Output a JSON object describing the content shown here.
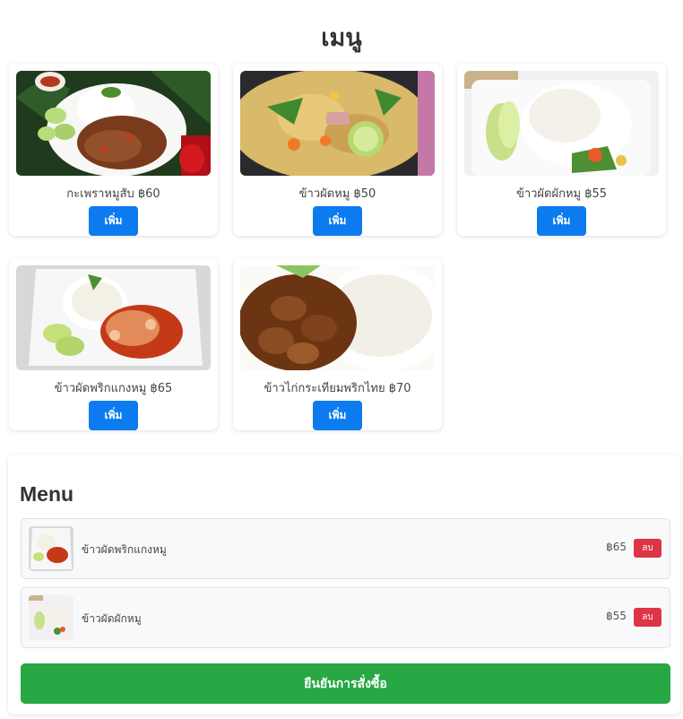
{
  "page": {
    "title": "เมนู"
  },
  "menu": {
    "items": [
      {
        "name": "กะเพราหมูสับ",
        "price": "฿60",
        "label": "กะเพราหมูสับ ฿60",
        "add_label": "เพิ่ม"
      },
      {
        "name": "ข้าวผัดหมู",
        "price": "฿50",
        "label": "ข้าวผัดหมู ฿50",
        "add_label": "เพิ่ม"
      },
      {
        "name": "ข้าวผัดผักหมู",
        "price": "฿55",
        "label": "ข้าวผัดผักหมู ฿55",
        "add_label": "เพิ่ม"
      },
      {
        "name": "ข้าวผัดพริกแกงหมู",
        "price": "฿65",
        "label": "ข้าวผัดพริกแกงหมู ฿65",
        "add_label": "เพิ่ม"
      },
      {
        "name": "ข้าวไก่กระเทียมพริกไทย",
        "price": "฿70",
        "label": "ข้าวไก่กระเทียมพริกไทย ฿70",
        "add_label": "เพิ่ม"
      }
    ]
  },
  "order": {
    "title": "Menu",
    "items": [
      {
        "name": "ข้าวผัดพริกแกงหมู",
        "price": "฿65",
        "remove_label": "ลบ"
      },
      {
        "name": "ข้าวผัดผักหมู",
        "price": "฿55",
        "remove_label": "ลบ"
      }
    ],
    "confirm_label": "ยืนยันการสั่งซื้อ"
  },
  "colors": {
    "add_button": "#0d7bf0",
    "remove_button": "#dc3545",
    "confirm_button": "#28a745"
  }
}
